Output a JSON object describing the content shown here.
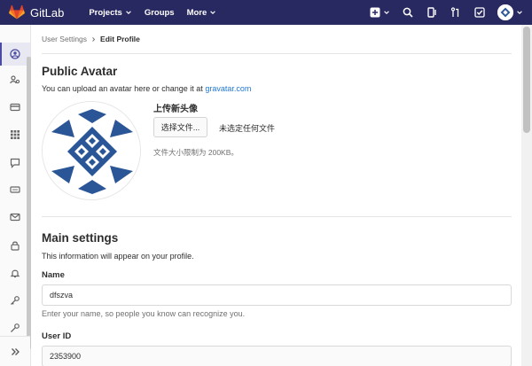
{
  "navbar": {
    "brand": "GitLab",
    "links": [
      {
        "label": "Projects"
      },
      {
        "label": "Groups"
      },
      {
        "label": "More"
      }
    ],
    "icons": [
      "plus-icon",
      "search-icon",
      "merge-request-icon",
      "issue-icon",
      "todo-icon",
      "user-avatar"
    ]
  },
  "sidebar": {
    "items": [
      "profile-icon",
      "account-icon",
      "billing-icon",
      "applications-icon",
      "chat-icon",
      "access-tokens-icon",
      "emails-icon",
      "password-icon",
      "notifications-icon",
      "ssh-keys-icon",
      "gpg-keys-icon"
    ],
    "collapse_icon": "double-chevron-right-icon"
  },
  "breadcrumb": {
    "parent": "User Settings",
    "current": "Edit Profile"
  },
  "avatar_section": {
    "title": "Public Avatar",
    "description": "You can upload an avatar here or change it at ",
    "link_text": "gravatar.com",
    "upload_title": "上传新头像",
    "choose_file_button": "选择文件...",
    "file_status": "未选定任何文件",
    "size_hint": "文件大小限制为 200KB。"
  },
  "main_settings": {
    "title": "Main settings",
    "description": "This information will appear on your profile.",
    "name_label": "Name",
    "name_value": "dfszva",
    "name_help": "Enter your name, so people you know can recognize you.",
    "user_id_label": "User ID",
    "user_id_value": "2353900"
  },
  "colors": {
    "navbar": "#292961",
    "link": "#1f78d1",
    "avatar_blue": "#2a5596"
  }
}
